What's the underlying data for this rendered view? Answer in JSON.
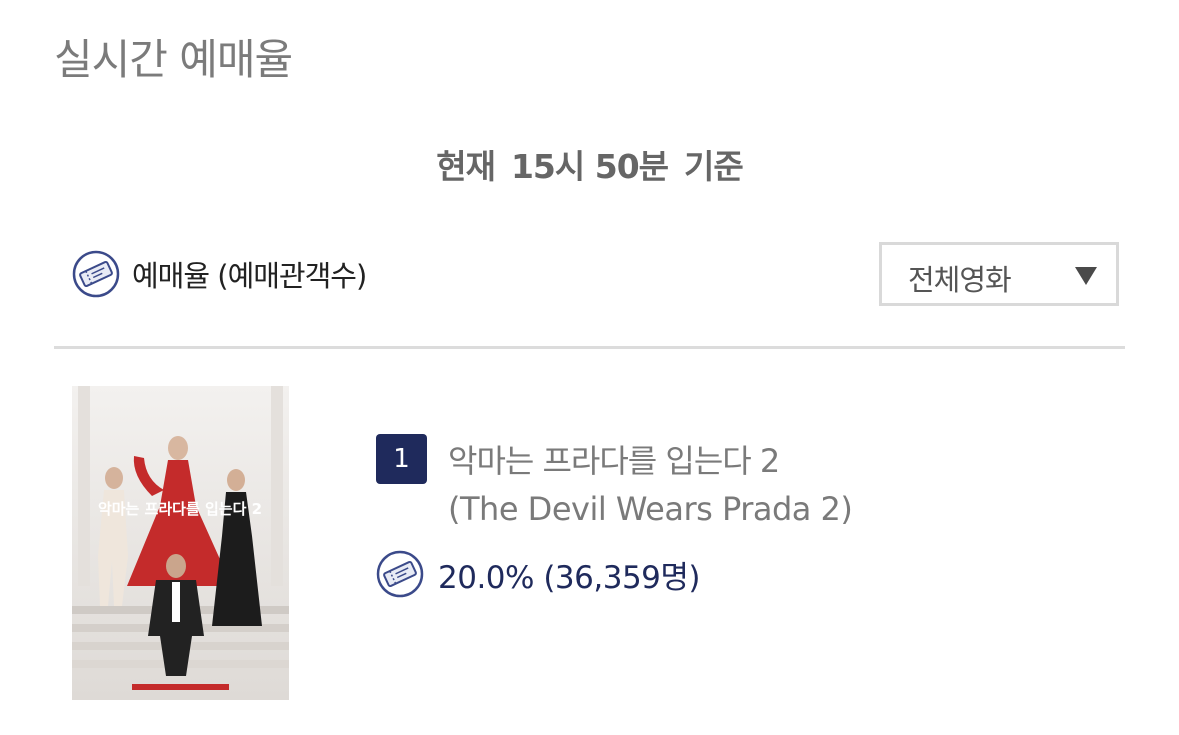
{
  "header": {
    "title": "실시간 예매율"
  },
  "time_info": {
    "prefix": "현재",
    "time": "15시 50분",
    "suffix": "기준"
  },
  "metric": {
    "label": "예매율 (예매관객수)",
    "icon": "ticket-icon"
  },
  "filter": {
    "selected": "전체영화",
    "icon": "caret-down-icon"
  },
  "movies": [
    {
      "rank": "1",
      "title_ko": "악마는 프라다를 입는다 2",
      "title_en": "(The Devil Wears Prada 2)",
      "rate": "20.0% (36,359명)",
      "poster_title": "악마는 프라다를 입는다 2"
    }
  ],
  "colors": {
    "accent": "#1f2a5c",
    "muted_text": "#7a7a7a",
    "border": "#d9d9d9",
    "poster_red": "#c42b2b"
  }
}
